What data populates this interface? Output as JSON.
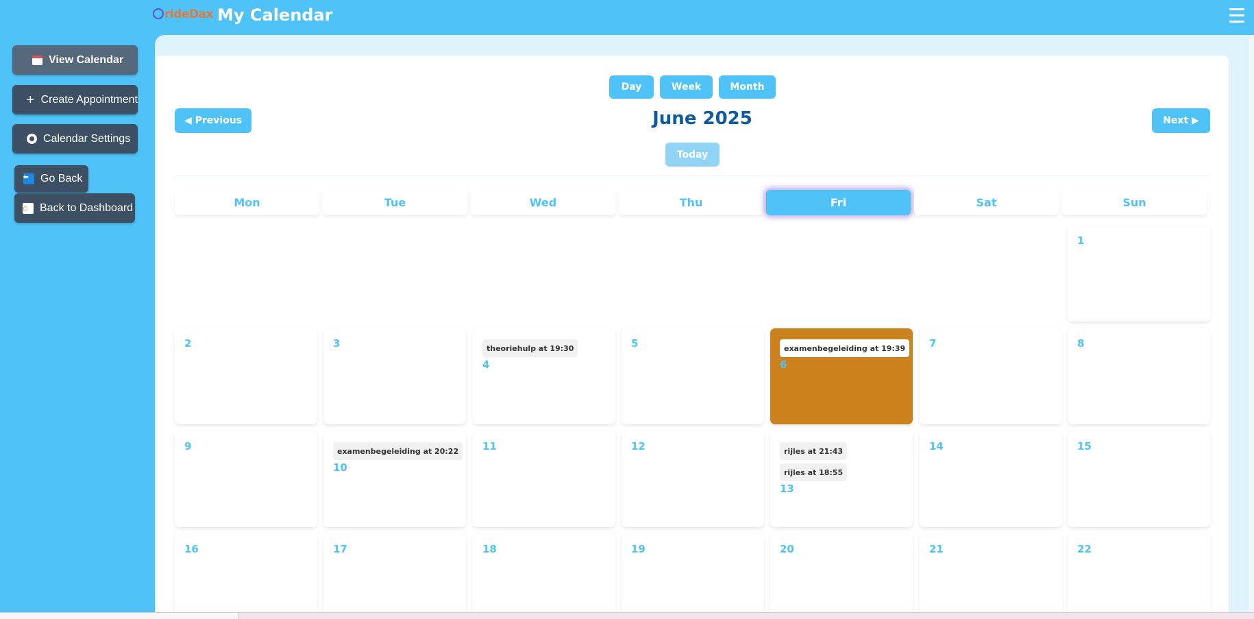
{
  "header": {
    "logo_text": "rideDax",
    "title": "My Calendar"
  },
  "sidebar": {
    "items": [
      {
        "label": "View Calendar",
        "icon": "calendar-icon"
      },
      {
        "label": "Create Appointment",
        "icon": "plus-icon"
      },
      {
        "label": "Calendar Settings",
        "icon": "gear-icon"
      },
      {
        "label": "Go Back",
        "icon": "back-icon"
      },
      {
        "label": "Back to Dashboard",
        "icon": "home-icon"
      }
    ]
  },
  "calendar": {
    "views": [
      "Day",
      "Week",
      "Month"
    ],
    "prev_label": "◀ Previous",
    "next_label": "Next ▶",
    "month_title": "June 2025",
    "today_label": "Today",
    "weekdays": [
      "Mon",
      "Tue",
      "Wed",
      "Thu",
      "Fri",
      "Sat",
      "Sun"
    ],
    "active_weekday": "Fri",
    "highlight_day": 6,
    "weeks": [
      [
        null,
        null,
        null,
        null,
        null,
        null,
        {
          "day": "1",
          "events": []
        }
      ],
      [
        {
          "day": "2",
          "events": []
        },
        {
          "day": "3",
          "events": []
        },
        {
          "day": "4",
          "events": [
            "theoriehulp at 19:30"
          ]
        },
        {
          "day": "5",
          "events": []
        },
        {
          "day": "6",
          "events": [
            "examenbegeleiding at 19:39"
          ]
        },
        {
          "day": "7",
          "events": []
        },
        {
          "day": "8",
          "events": []
        }
      ],
      [
        {
          "day": "9",
          "events": []
        },
        {
          "day": "10",
          "events": [
            "examenbegeleiding at 20:22"
          ]
        },
        {
          "day": "11",
          "events": []
        },
        {
          "day": "12",
          "events": []
        },
        {
          "day": "13",
          "events": [
            "rijles at 21:43",
            "rijles at 18:55"
          ]
        },
        {
          "day": "14",
          "events": []
        },
        {
          "day": "15",
          "events": []
        }
      ],
      [
        {
          "day": "16",
          "events": []
        },
        {
          "day": "17",
          "events": []
        },
        {
          "day": "18",
          "events": []
        },
        {
          "day": "19",
          "events": []
        },
        {
          "day": "20",
          "events": []
        },
        {
          "day": "21",
          "events": []
        },
        {
          "day": "22",
          "events": []
        }
      ]
    ]
  },
  "colors": {
    "accent": "#4fc3f7",
    "title": "#0d5a9c",
    "highlight_cell": "#cc821c",
    "sidebar_button": "#3d4f63"
  }
}
